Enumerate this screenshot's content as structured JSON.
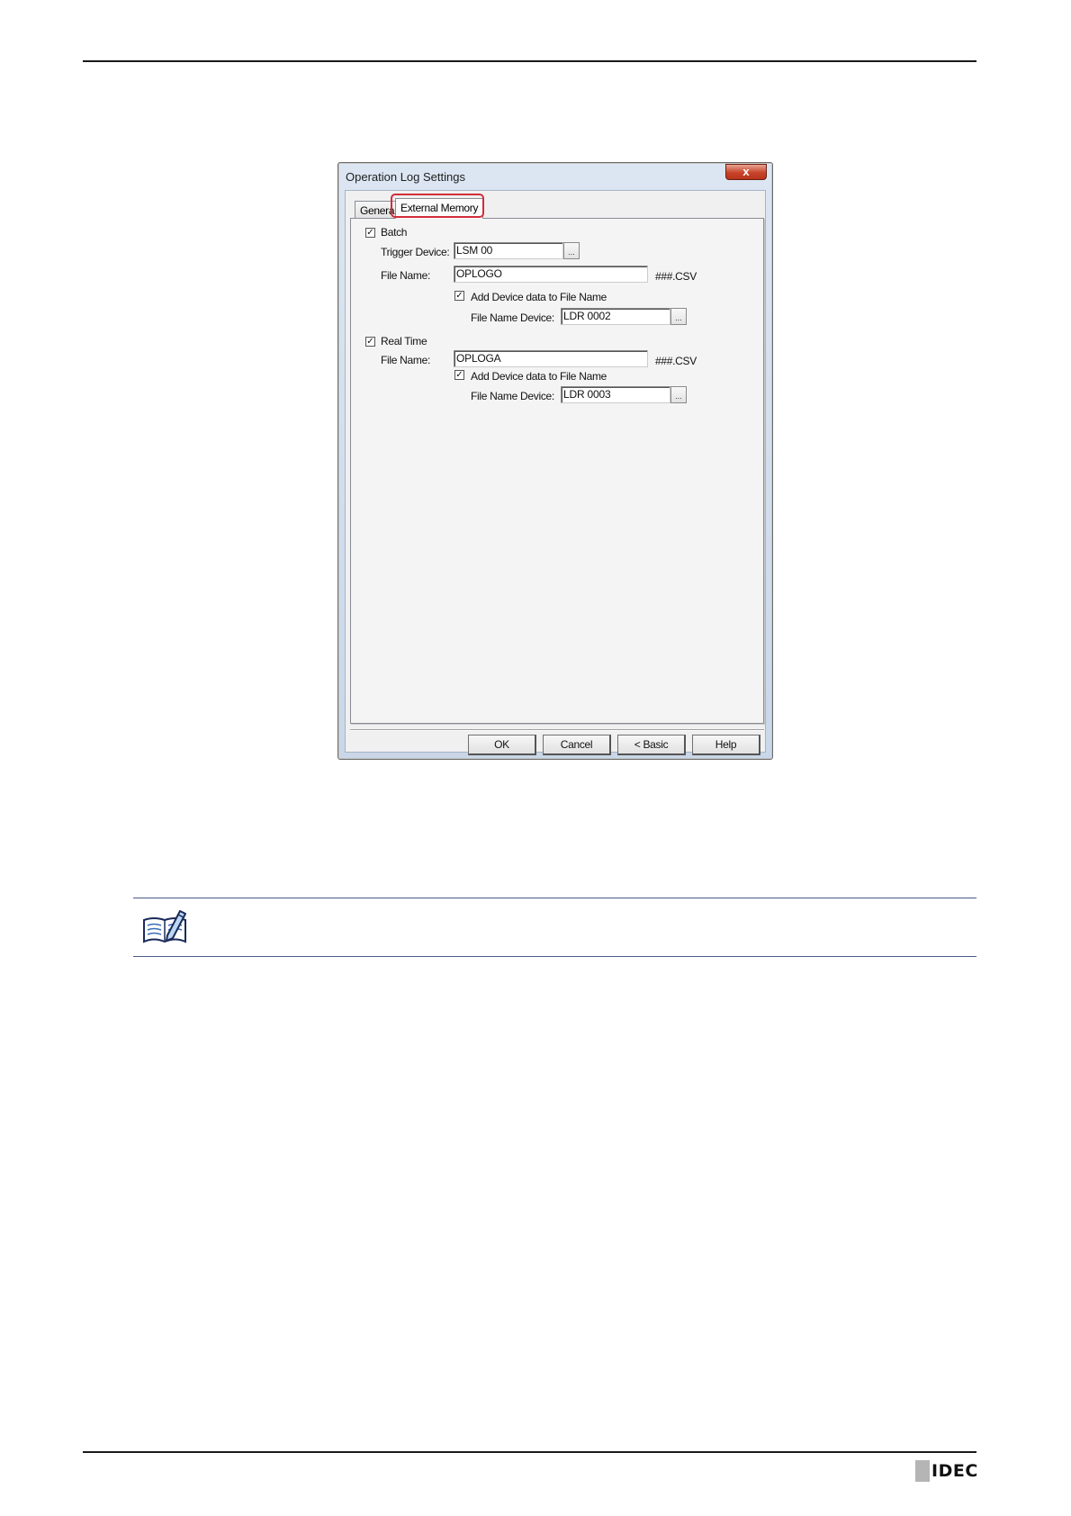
{
  "dialog": {
    "title": "Operation Log Settings",
    "close_glyph": "x",
    "tabs": [
      {
        "label": "General",
        "selected": false
      },
      {
        "label": "External Memory",
        "selected": true
      }
    ],
    "batch": {
      "checkbox_label": "Batch",
      "checked": true,
      "trigger_device_label": "Trigger Device:",
      "trigger_device_value": "LSM 00",
      "file_name_label": "File Name:",
      "file_name_value": "OPLOGO",
      "file_suffix": "###.CSV",
      "add_device_label": "Add Device data to File Name",
      "add_device_checked": true,
      "file_name_device_label": "File Name Device:",
      "file_name_device_value": "LDR 0002"
    },
    "real_time": {
      "checkbox_label": "Real Time",
      "checked": true,
      "file_name_label": "File Name:",
      "file_name_value": "OPLOGA",
      "file_suffix": "###.CSV",
      "add_device_label": "Add Device data to File Name",
      "add_device_checked": true,
      "file_name_device_label": "File Name Device:",
      "file_name_device_value": "LDR 0003"
    },
    "browse_label": "...",
    "check_glyph": "✓",
    "buttons": {
      "ok": "OK",
      "cancel": "Cancel",
      "basic": "< Basic",
      "help": "Help"
    },
    "highlight_color": "#d32d3a"
  },
  "logo": {
    "text": "IDEC"
  }
}
